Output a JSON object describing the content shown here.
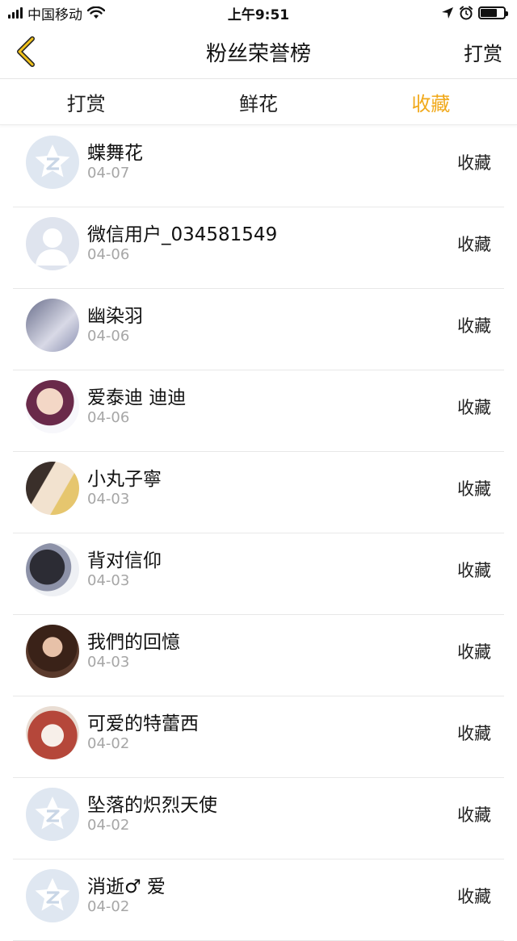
{
  "status_bar": {
    "carrier": "中国移动",
    "time": "上午9:51"
  },
  "nav": {
    "title": "粉丝荣誉榜",
    "right_label": "打赏"
  },
  "tabs": [
    {
      "label": "打赏",
      "active": false
    },
    {
      "label": "鲜花",
      "active": false
    },
    {
      "label": "收藏",
      "active": true
    }
  ],
  "accent_color": "#f1a91b",
  "rows": [
    {
      "name": "蝶舞花",
      "date": "04-07",
      "action": "收藏",
      "avatar": "default-z-avatar"
    },
    {
      "name": "微信用户_034581549",
      "date": "04-06",
      "action": "收藏",
      "avatar": "default-user-avatar"
    },
    {
      "name": "幽染羽",
      "date": "04-06",
      "action": "收藏",
      "avatar": "photo-avatar"
    },
    {
      "name": "爱泰迪 迪迪",
      "date": "04-06",
      "action": "收藏",
      "avatar": "photo-avatar"
    },
    {
      "name": "小丸子寧",
      "date": "04-03",
      "action": "收藏",
      "avatar": "photo-avatar"
    },
    {
      "name": "背对信仰",
      "date": "04-03",
      "action": "收藏",
      "avatar": "photo-avatar"
    },
    {
      "name": "我們的回憶",
      "date": "04-03",
      "action": "收藏",
      "avatar": "photo-avatar"
    },
    {
      "name": "可爱的特蕾西",
      "date": "04-02",
      "action": "收藏",
      "avatar": "photo-avatar"
    },
    {
      "name": "坠落的炽烈天使",
      "date": "04-02",
      "action": "收藏",
      "avatar": "default-z-avatar"
    },
    {
      "name": "消逝♂ 爱",
      "date": "04-02",
      "action": "收藏",
      "avatar": "default-z-avatar"
    }
  ]
}
